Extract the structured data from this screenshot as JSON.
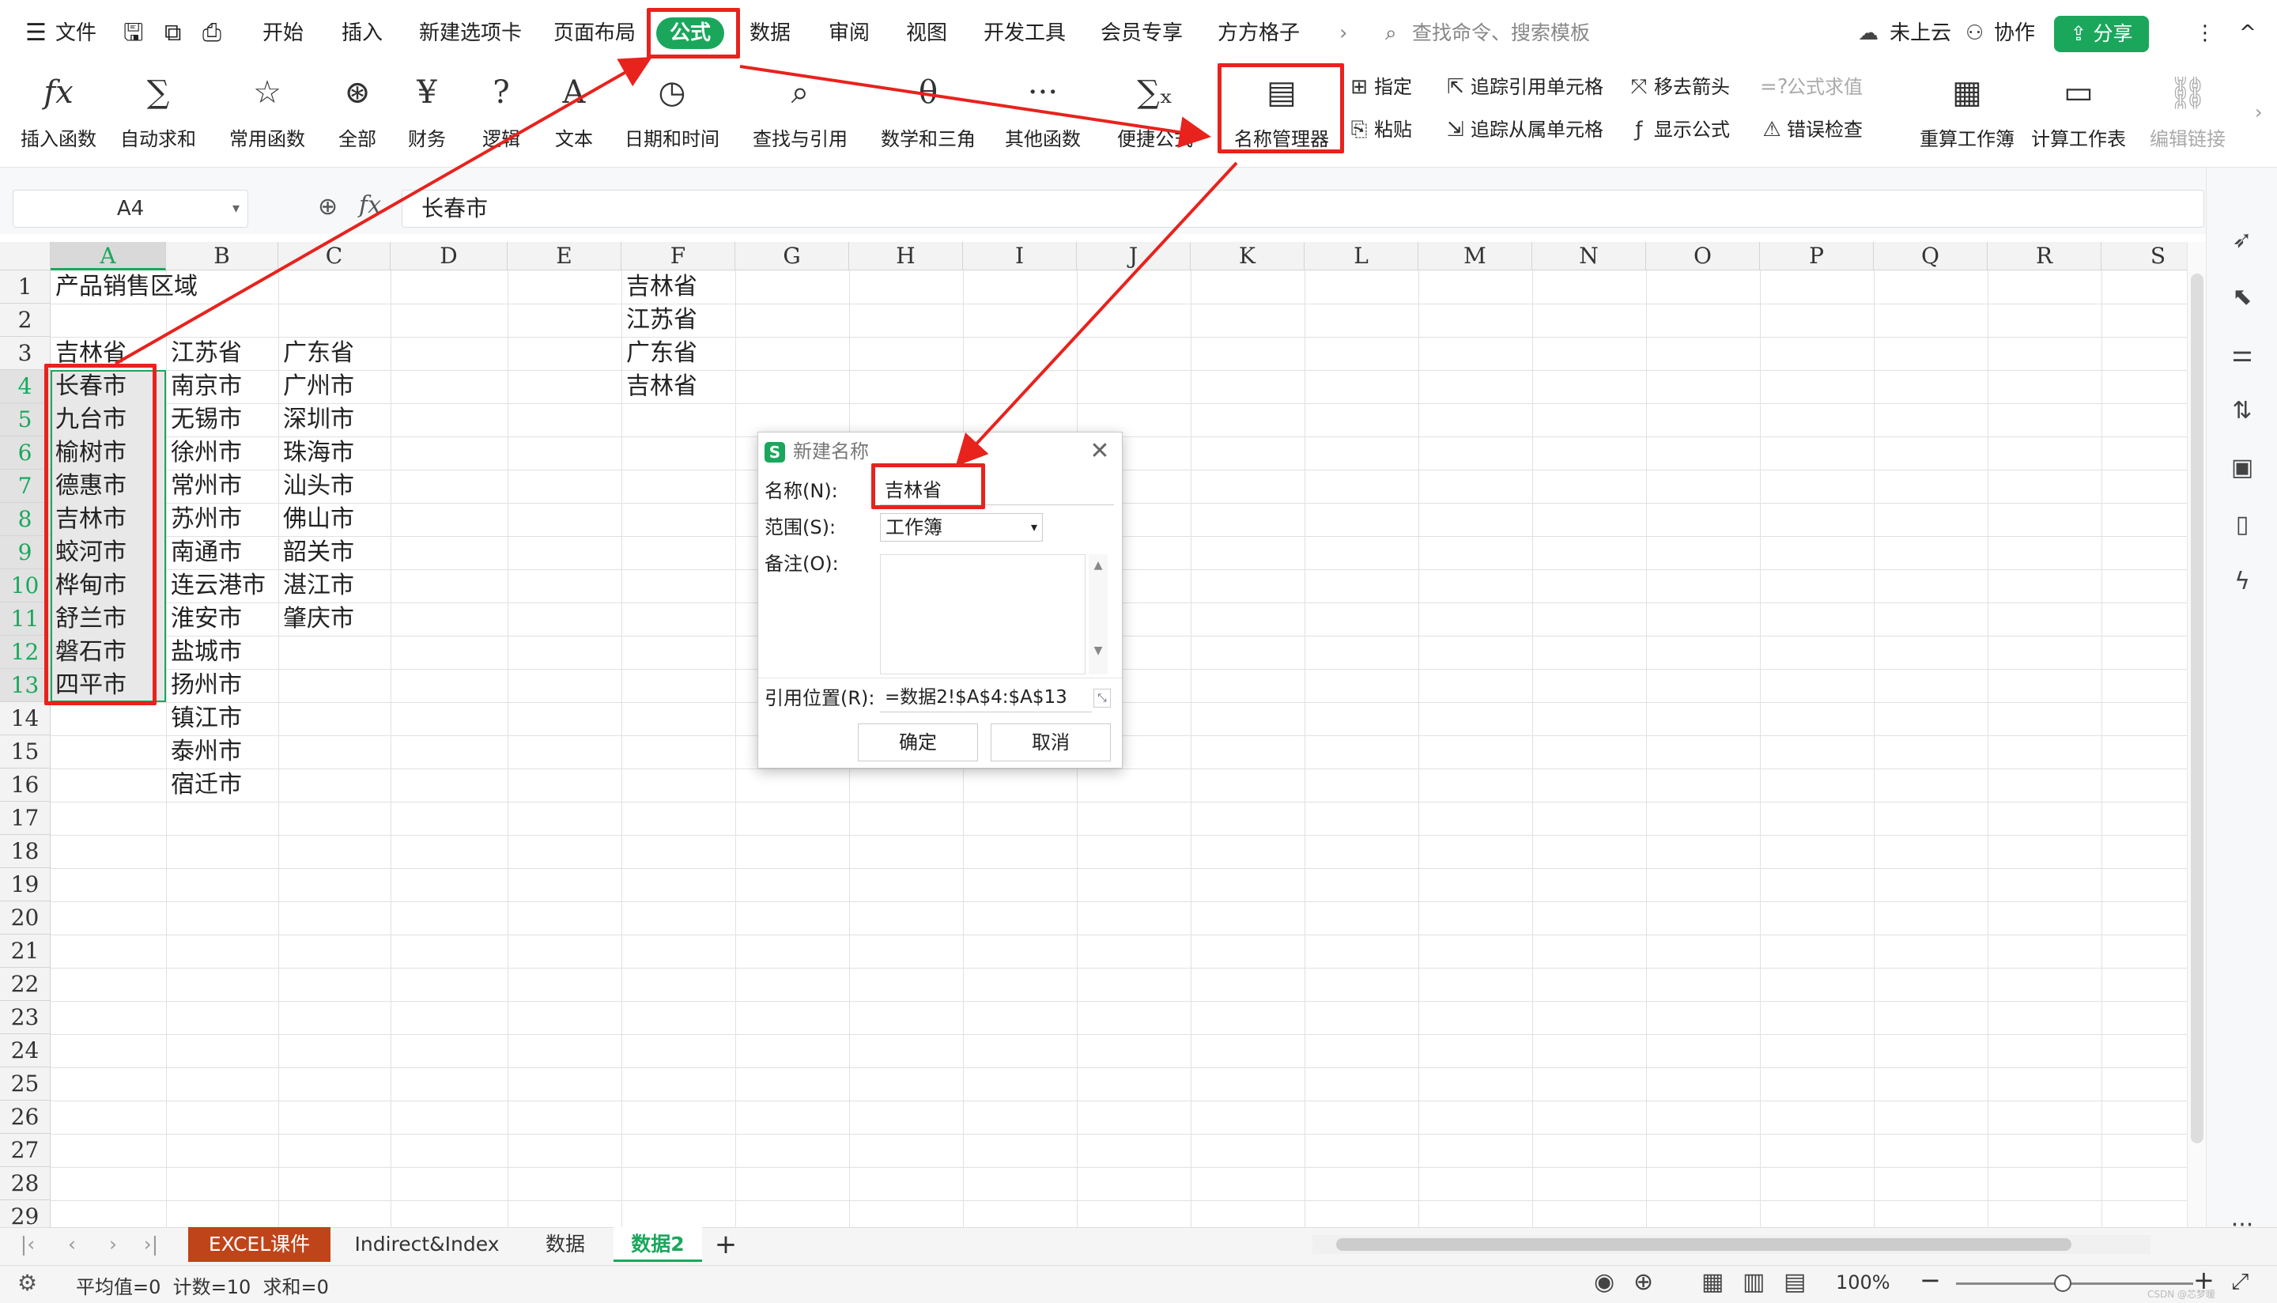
{
  "menu": {
    "file": "文件",
    "tabs": [
      "开始",
      "插入",
      "新建选项卡",
      "页面布局"
    ],
    "active_tab": "公式",
    "tabs_after": [
      "数据",
      "审阅",
      "视图",
      "开发工具",
      "会员专享",
      "方方格子"
    ],
    "more": "›",
    "search_placeholder": "查找命令、搜索模板",
    "cloud": "未上云",
    "collab": "协作",
    "share": "分享",
    "more_dots": "⋮",
    "collapse": "^"
  },
  "ribbon": {
    "insert_function": "插入函数",
    "autosum": "自动求和",
    "common": "常用函数",
    "all": "全部",
    "finance": "财务",
    "logic": "逻辑",
    "text": "文本",
    "datetime": "日期和时间",
    "lookup": "查找与引用",
    "math": "数学和三角",
    "other": "其他函数",
    "quick": "便捷公式",
    "name_manager": "名称管理器",
    "specify": "指定",
    "paste": "粘贴",
    "trace_precedents": "追踪引用单元格",
    "trace_dependents": "追踪从属单元格",
    "remove_arrows": "移去箭头",
    "show_formulas": "显示公式",
    "eval_formula": "公式求值",
    "error_check": "错误检查",
    "recalc_workbook": "重算工作簿",
    "calc_sheet": "计算工作表",
    "edit_links": "编辑链接"
  },
  "formula_bar": {
    "cell_ref": "A4",
    "fx": "fx",
    "value": "长春市"
  },
  "grid": {
    "columns": [
      "A",
      "B",
      "C",
      "D",
      "E",
      "F",
      "G",
      "H",
      "I",
      "J",
      "K",
      "L",
      "M",
      "N",
      "O",
      "P",
      "Q",
      "R",
      "S"
    ],
    "rows": [
      "1",
      "2",
      "3",
      "4",
      "5",
      "6",
      "7",
      "8",
      "9",
      "10",
      "11",
      "12",
      "13",
      "14",
      "15",
      "16",
      "17",
      "18",
      "19",
      "20",
      "21",
      "22",
      "23",
      "24",
      "25",
      "26",
      "27",
      "28",
      "29"
    ],
    "colA": [
      "产品销售区域",
      "",
      "吉林省",
      "长春市",
      "九台市",
      "榆树市",
      "德惠市",
      "吉林市",
      "蛟河市",
      "桦甸市",
      "舒兰市",
      "磐石市",
      "四平市"
    ],
    "colB": [
      "",
      "",
      "江苏省",
      "南京市",
      "无锡市",
      "徐州市",
      "常州市",
      "苏州市",
      "南通市",
      "连云港市",
      "淮安市",
      "盐城市",
      "扬州市",
      "镇江市",
      "泰州市",
      "宿迁市"
    ],
    "colC": [
      "",
      "",
      "广东省",
      "广州市",
      "深圳市",
      "珠海市",
      "汕头市",
      "佛山市",
      "韶关市",
      "湛江市",
      "肇庆市"
    ],
    "colF": [
      "吉林省",
      "江苏省",
      "广东省",
      "吉林省"
    ]
  },
  "dialog": {
    "title": "新建名称",
    "logo": "S",
    "close": "✕",
    "name_label": "名称(N):",
    "name_value": "吉林省",
    "scope_label": "范围(S):",
    "scope_value": "工作簿",
    "comment_label": "备注(O):",
    "ref_label": "引用位置(R):",
    "ref_value": "=数据2!$A$4:$A$13",
    "ok": "确定",
    "cancel": "取消"
  },
  "sheets": {
    "tabs": [
      "EXCEL课件",
      "Indirect&Index",
      "数据",
      "数据2"
    ],
    "active": "数据2",
    "add": "+"
  },
  "status": {
    "summary": "平均值=0  计数=10  求和=0",
    "zoom": "100%",
    "watermark": "CSDN @芯梦暖"
  },
  "colors": {
    "accent": "#1aa75c",
    "annotation": "#e8221d",
    "first_tab": "#c0441a"
  }
}
